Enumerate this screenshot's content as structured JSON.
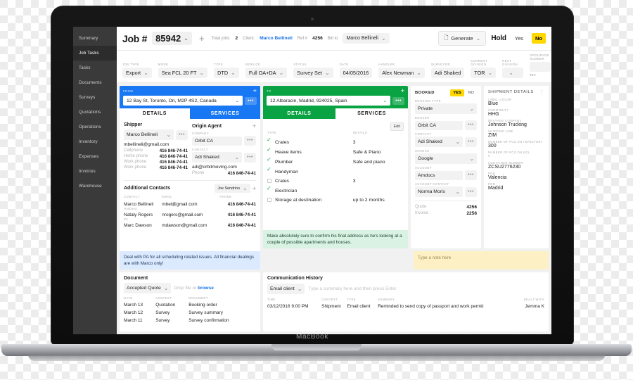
{
  "device": {
    "brand": "MacBook"
  },
  "sidebar": {
    "items": [
      {
        "label": "Summary",
        "active": false
      },
      {
        "label": "Job Tasks",
        "active": true
      },
      {
        "label": "Tasks",
        "active": false
      },
      {
        "label": "Documents",
        "active": false
      },
      {
        "label": "Surveys",
        "active": false
      },
      {
        "label": "Quotations",
        "active": false
      },
      {
        "label": "Operations",
        "active": false
      },
      {
        "label": "Inventory",
        "active": false
      },
      {
        "label": "Expenses",
        "active": false
      },
      {
        "label": "Invoices",
        "active": false
      },
      {
        "label": "Warehouse",
        "active": false
      }
    ]
  },
  "topbar": {
    "job_label": "Job #",
    "job_number": "85942",
    "add_label": "+",
    "total_jobs_label": "Total jobs:",
    "total_jobs_value": "2",
    "client_label": "Client:",
    "client_value": "Marco Bellineli",
    "ref_label": "Ref #",
    "ref_value": "4256",
    "bill_to_label": "Bill to",
    "bill_to_value": "Marco Bellineli",
    "generate_label": "Generate",
    "hold_label": "Hold",
    "hold_yes": "Yes",
    "hold_no": "No",
    "hold_selected": "No"
  },
  "meta": [
    {
      "label": "JOB TYPE",
      "value": "Export",
      "caret": true
    },
    {
      "label": "MODE",
      "value": "Sea FCL 20 FT",
      "caret": true
    },
    {
      "label": "TYPE",
      "value": "DTD",
      "caret": true
    },
    {
      "label": "SERVICE",
      "value": "Full OA+DA",
      "caret": true
    },
    {
      "label": "STATUS",
      "value": "Survey Set",
      "caret": true
    },
    {
      "label": "DATE",
      "value": "04/05/2016",
      "caret": false
    },
    {
      "label": "HANDLER",
      "value": "Alex Newman",
      "caret": true
    },
    {
      "label": "SURVEYOR",
      "value": "Adi Shaked",
      "caret": false
    },
    {
      "label": "CURRENT DIVISION",
      "value": "TOR",
      "caret": true
    },
    {
      "label": "NEXT DIVISION",
      "value": "",
      "caret": true
    },
    {
      "label": "GROUPAGE NUMBER",
      "value": "",
      "caret": false
    }
  ],
  "from_card": {
    "label": "FROM",
    "address": "12 Bay St, Toronto, On, M2P 4S2, Canada",
    "tabs": [
      {
        "label": "DETAILS",
        "active": true
      },
      {
        "label": "SERVICES",
        "active": false
      }
    ]
  },
  "to_card": {
    "label": "TO",
    "address": "12 Albaracin, Madrid, 924025, Spain",
    "tabs": [
      {
        "label": "DETAILS",
        "active": false
      },
      {
        "label": "SERVICES",
        "active": true
      }
    ]
  },
  "shipper": {
    "title": "Shipper",
    "name": "Marco Bellineli",
    "email": "mbellineli@gmail.com",
    "phones": [
      {
        "label": "Cellphone",
        "value": "416 846-74-41"
      },
      {
        "label": "Home phone",
        "value": "416 846-74-41"
      },
      {
        "label": "Work phone",
        "value": "416 846-74-41"
      },
      {
        "label": "Work phone",
        "value": "416 846-74-41"
      }
    ]
  },
  "origin_agent": {
    "title": "Origin Agent",
    "company_label": "COMPANY",
    "company": "Orbit CA",
    "contact_label": "CONTACT",
    "contact": "Adi Shaked",
    "email": "adi@orbitmoving.com",
    "phone_label": "Phone",
    "phone": "416 846-74-41"
  },
  "additional_contacts": {
    "title": "Additional Contacts",
    "filter": "Joe Sendrino",
    "columns": [
      "CONTACT",
      "EMAIL",
      "PHONE"
    ],
    "rows": [
      {
        "name": "Marco Bellineli",
        "role": "Husband",
        "email": "mbel@gmail.com",
        "phone": "416 846-74-41"
      },
      {
        "name": "Nataly Rogers",
        "role": "PA",
        "email": "nrogers@gmail.com",
        "phone": "416 846-74-41"
      },
      {
        "name": "Marc Dawson",
        "role": "",
        "email": "mdawson@gmail.com",
        "phone": "416 846-74-41"
      }
    ],
    "note": "Deal with PA for all scheduling related issues. All financial dealings are with Marco only!"
  },
  "document": {
    "title": "Document",
    "type_select": "Accepted Quote",
    "drop_text": "Drop file or",
    "browse_text": "browse",
    "columns": [
      "DATE",
      "CONTEXT",
      "DOCUMENT"
    ],
    "rows": [
      {
        "date": "March 13",
        "context": "Quotation",
        "document": "Booking order"
      },
      {
        "date": "March 12",
        "context": "Survey",
        "document": "Survey summary"
      },
      {
        "date": "March 11",
        "context": "Survey",
        "document": "Survey confirmation"
      }
    ]
  },
  "services": {
    "edit_label": "Edit",
    "columns": [
      "TYPE",
      "DETAILS"
    ],
    "rows": [
      {
        "checked": true,
        "type": "Crates",
        "details": "3"
      },
      {
        "checked": true,
        "type": "Heave items",
        "details": "Safe & Piano"
      },
      {
        "checked": true,
        "type": "Plumber",
        "details": "Safe and piano"
      },
      {
        "checked": true,
        "type": "Handyman",
        "details": ""
      },
      {
        "checked": false,
        "type": "Crates",
        "details": "3"
      },
      {
        "checked": true,
        "type": "Electrician",
        "details": ""
      },
      {
        "checked": false,
        "type": "Storage at destination",
        "details": "up to 2 months"
      }
    ],
    "note": "Make absolutely sure to confirm his final address as he's looking at a couple of possible apartments and houses."
  },
  "booked": {
    "title": "BOOKED",
    "yes": "YES",
    "no": "NO",
    "selected": "YES",
    "fields": [
      {
        "label": "BOOKING TYPE",
        "value": "Private",
        "caret": true,
        "dots": false
      },
      {
        "label": "BOOKER",
        "value": "Orbit CA",
        "caret": false,
        "dots": true
      },
      {
        "label": "CONTACT",
        "value": "Adi Shaked",
        "caret": true,
        "dots": true
      },
      {
        "label": "SOURCE",
        "value": "Google",
        "caret": true,
        "dots": false
      },
      {
        "label": "ACCOUNT",
        "value": "Amdocs",
        "caret": false,
        "dots": true
      },
      {
        "label": "ACCOUNT CONTACT",
        "value": "Norma Moris",
        "caret": true,
        "dots": true
      }
    ],
    "totals": [
      {
        "label": "Quote",
        "value": "4256"
      },
      {
        "label": "Invoice",
        "value": "2256"
      }
    ]
  },
  "shipment_details": {
    "title": "SHIPMENT DETAILS",
    "items": [
      {
        "label": "LABEL COLOR",
        "value": "Blue"
      },
      {
        "label": "COMMODITY",
        "value": "HHG"
      },
      {
        "label": "DRAYAGE COMPANY",
        "value": "Johnson Trucking"
      },
      {
        "label": "SHIPPING LINE",
        "value": "ZIM"
      },
      {
        "label": "NUMBER OF PCS ON INVENTORY",
        "value": "300"
      },
      {
        "label": "NUMBER OF PCS ON BOL",
        "value": "-"
      },
      {
        "label": "CONTAINER NUMBER",
        "value": "ZCSU2776230"
      },
      {
        "label": "POE",
        "value": "Valencia"
      },
      {
        "label": "POD",
        "value": "Madrid"
      }
    ]
  },
  "note_placeholder": "Type a note here",
  "communication": {
    "title": "Communication History",
    "channel": "Email client",
    "input_placeholder": "Type a summary here and then press Enter",
    "columns": [
      "TIME",
      "CONTEXT",
      "TYPE",
      "SUMMARY",
      "DEALT WITH"
    ],
    "rows": [
      {
        "time": "03/12/2016 9:00 PM",
        "context": "Shipment",
        "type": "Email client",
        "summary": "Reminded to send copy of passport and work permit",
        "dealt_with": "Jemma K"
      }
    ]
  }
}
